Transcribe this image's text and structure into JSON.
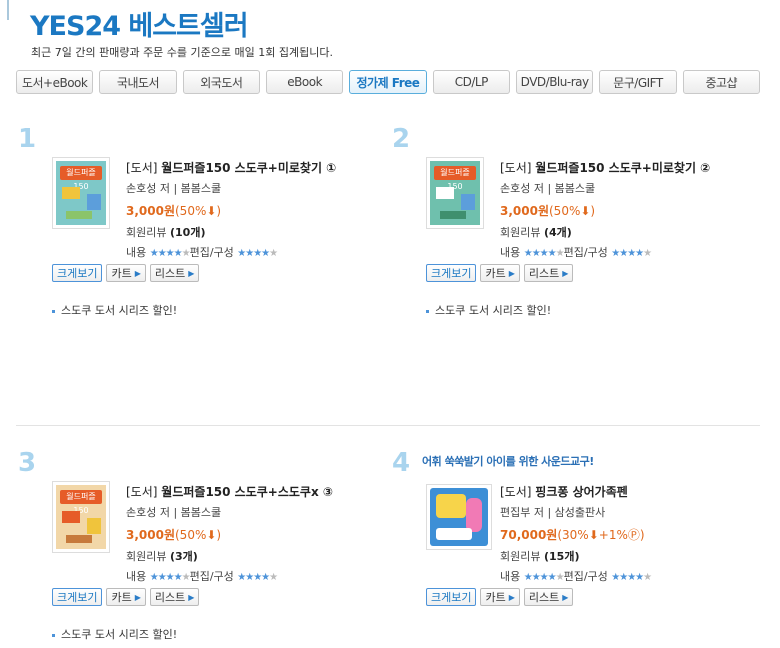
{
  "header": {
    "title": "YES24 베스트셀러",
    "subtitle": "최근 7일 간의 판매량과 주문 수를 기준으로 매일 1회 집계됩니다."
  },
  "tabs": [
    {
      "label": "도서+eBook"
    },
    {
      "label": "국내도서"
    },
    {
      "label": "외국도서"
    },
    {
      "label": "eBook"
    },
    {
      "label": "정가제 Free",
      "active": true
    },
    {
      "label": "CD/LP"
    },
    {
      "label": "DVD/Blu-ray"
    },
    {
      "label": "문구/GIFT"
    },
    {
      "label": "중고샵"
    }
  ],
  "common": {
    "review_label": "회원리뷰",
    "content_label": "내용",
    "design_label": "편집/구성",
    "zoom_button": "크게보기",
    "cart_button": "카트",
    "list_button": "리스트"
  },
  "items": [
    {
      "rank": "1",
      "promo": "",
      "category": "[도서]",
      "title": "월드퍼즐150 스도쿠+미로찾기 ①",
      "author": "손호성 저 | 봄봄스쿨",
      "price": "3,000원",
      "discount": "(50%⬇)",
      "review_count": "(10개)",
      "note": "스도쿠 도서 시리즈 할인!",
      "cover_text": "월드퍼즐150"
    },
    {
      "rank": "2",
      "promo": "",
      "category": "[도서]",
      "title": "월드퍼즐150 스도쿠+미로찾기 ②",
      "author": "손호성 저 | 봄봄스쿨",
      "price": "3,000원",
      "discount": "(50%⬇)",
      "review_count": "(4개)",
      "note": "스도쿠 도서 시리즈 할인!",
      "cover_text": "월드퍼즐150"
    },
    {
      "rank": "3",
      "promo": "",
      "category": "[도서]",
      "title": "월드퍼즐150 스도쿠+스도쿠x ③",
      "author": "손호성 저 | 봄봄스쿨",
      "price": "3,000원",
      "discount": "(50%⬇)",
      "review_count": "(3개)",
      "note": "스도쿠 도서 시리즈 할인!",
      "cover_text": "월드퍼즐150"
    },
    {
      "rank": "4",
      "promo": "어휘 쑥쑥발기 아이를 위한 사운드교구!",
      "category": "[도서]",
      "title": "핑크퐁 상어가족펜",
      "author": "편집부 저 | 삼성출판사",
      "price": "70,000원",
      "discount": "(30%⬇+1%Ⓟ)",
      "review_count": "(15개)",
      "note": "",
      "cover_text": ""
    }
  ],
  "colors": {
    "brand": "#1b78c2",
    "rank": "#a9d4ee",
    "price": "#e0691d",
    "star": "#4d93d9"
  }
}
